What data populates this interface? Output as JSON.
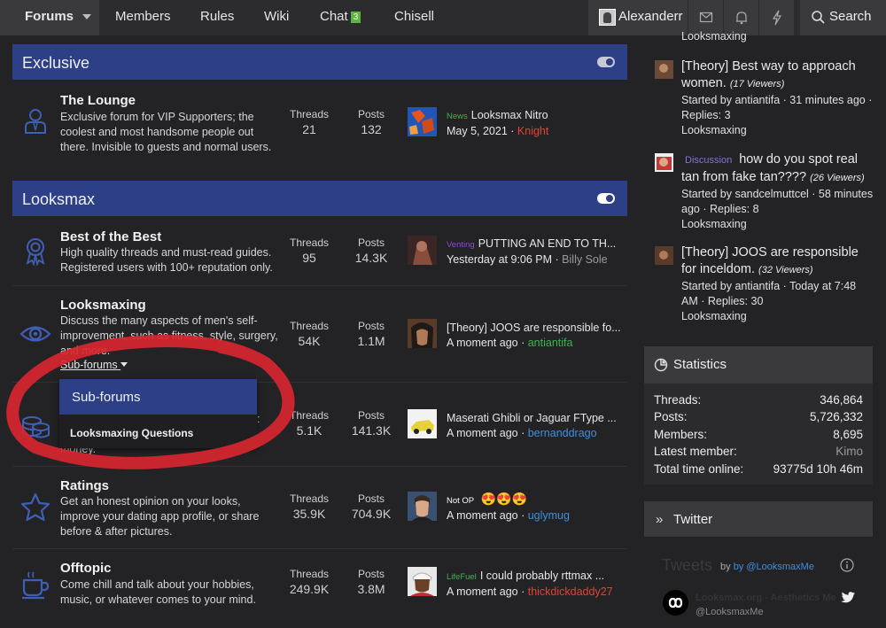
{
  "nav": {
    "forums": "Forums",
    "members": "Members",
    "rules": "Rules",
    "wiki": "Wiki",
    "chat": "Chat",
    "chat_badge": "3",
    "chisell": "Chisell",
    "username": "Alexanderr",
    "search": "Search",
    "icons": [
      "envelope-icon",
      "bell-icon",
      "bolt-icon",
      "search-icon"
    ]
  },
  "categories": {
    "exclusive": "Exclusive",
    "looksmax": "Looksmax"
  },
  "labels": {
    "threads": "Threads",
    "posts": "Posts",
    "subforums": "Sub-forums"
  },
  "nodes": [
    {
      "title": "The Lounge",
      "desc": "Exclusive forum for VIP Supporters; the coolest and most handsome people out there. Invisible to guests and normal users.",
      "threads": "21",
      "posts": "132",
      "prefix": "News",
      "prefix_color": "#3fb34f",
      "last_title": "Looksmax Nitro",
      "last_date": "May 5, 2021",
      "last_user": "Knight",
      "user_color": "#e8412f"
    },
    {
      "title": "Best of the Best",
      "desc": "High quality threads and must-read guides. Registered users with 100+ reputation only.",
      "threads": "95",
      "posts": "14.3K",
      "prefix": "Venting",
      "prefix_color": "#8a4fc9",
      "last_title": "PUTTING AN END TO TH...",
      "last_date": "Yesterday at 9:06 PM",
      "last_user": "Billy Sole",
      "user_color": "#9a9a9a"
    },
    {
      "title": "Looksmaxing",
      "desc": "Discuss the many aspects of men's self-improvement, such as fitness, style, surgery, and more.",
      "threads": "54K",
      "posts": "1.1M",
      "prefix": "",
      "prefix_color": "",
      "last_title": "[Theory] JOOS are responsible fo...",
      "last_date": "A moment ago",
      "last_user": "antiantifa",
      "user_color": "#3fb34f"
    },
    {
      "title": "",
      "desc": "money.",
      "threads": "5.1K",
      "posts": "141.3K",
      "prefix": "",
      "prefix_color": "",
      "last_title": "Maserati Ghibli or Jaguar FType ...",
      "last_date": "A moment ago",
      "last_user": "bernanddrago",
      "user_color": "#3e8fdc"
    },
    {
      "title": "Ratings",
      "desc": "Get an honest opinion on your looks, improve your dating app profile, or share before & after pictures.",
      "threads": "35.9K",
      "posts": "704.9K",
      "prefix": "Not OP",
      "prefix_color": "#ffffff",
      "last_title": "😍😍😍",
      "last_date": "A moment ago",
      "last_user": "uglymug",
      "user_color": "#3e8fdc"
    },
    {
      "title": "Offtopic",
      "desc": "Come chill and talk about your hobbies, music, or whatever comes to your mind.",
      "threads": "249.9K",
      "posts": "3.8M",
      "prefix": "LifeFuel",
      "prefix_color": "#3fb34f",
      "last_title": "I could probably rttmax ...",
      "last_date": "A moment ago",
      "last_user": "thickdickdaddy27",
      "user_color": "#e8412f"
    }
  ],
  "dropdown": {
    "header": "Sub-forums",
    "item": "Looksmaxing Questions"
  },
  "right_posts": {
    "top_fragment": "Looksmaxing",
    "items": [
      {
        "prefix": "",
        "title": "[Theory] Best way to approach women.",
        "viewers": "(17 Viewers)",
        "meta": "Started by antiantifa · 31 minutes ago · Replies: 3",
        "forum": "Looksmaxing"
      },
      {
        "prefix": "Discussion",
        "title": "how do you spot real tan from fake tan????",
        "viewers": "(26 Viewers)",
        "meta": "Started by sandcelmuttcel · 58 minutes ago · Replies: 8",
        "forum": "Looksmaxing"
      },
      {
        "prefix": "",
        "title": "[Theory] JOOS are responsible for inceldom.",
        "viewers": "(32 Viewers)",
        "meta": "Started by antiantifa · Today at 7:48 AM · Replies: 30",
        "forum": "Looksmaxing"
      }
    ]
  },
  "statistics": {
    "title": "Statistics",
    "rows": [
      {
        "label": "Threads:",
        "value": "346,864"
      },
      {
        "label": "Posts:",
        "value": "5,726,332"
      },
      {
        "label": "Members:",
        "value": "8,695"
      },
      {
        "label": "Latest member:",
        "value": "Kimo"
      },
      {
        "label": "Total time online:",
        "value": "93775d 10h 46m"
      }
    ]
  },
  "twitter": {
    "title": "Twitter",
    "tweets_heading": "Tweets",
    "by": "by @LooksmaxMe",
    "account_name": "Looksmax.org - Aesthetics Me",
    "handle": "@LooksmaxMe"
  },
  "colors": {
    "category_blue": "#2d3f86",
    "link_blue": "#3e8fdc",
    "red_circle": "#d8262f"
  }
}
